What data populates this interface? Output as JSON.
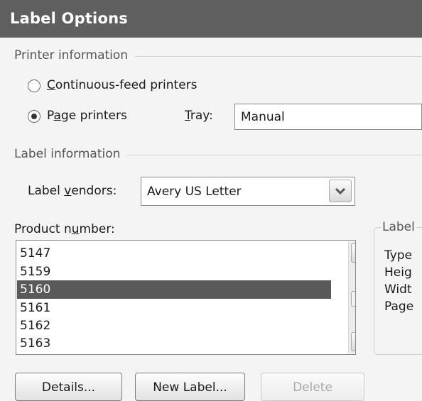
{
  "dialog": {
    "title": "Label Options"
  },
  "printer_info": {
    "group_label": "Printer information",
    "continuous_feed": {
      "label_before": "",
      "label_underlined": "C",
      "label_after": "ontinuous-feed printers",
      "selected": false
    },
    "page_printers": {
      "label_before": "P",
      "label_underlined": "a",
      "label_after": "ge printers",
      "selected": true
    },
    "tray": {
      "label_before": "",
      "label_underlined": "T",
      "label_after": "ray:",
      "value": "Manual"
    }
  },
  "label_info": {
    "group_label": "Label information",
    "vendors": {
      "label_before": "Label ",
      "label_underlined": "v",
      "label_after": "endors:",
      "value": "Avery US Letter"
    }
  },
  "product": {
    "label_before": "Product n",
    "label_underlined": "u",
    "label_after": "mber:",
    "items": [
      "5147",
      "5159",
      "5160",
      "5161",
      "5162",
      "5163"
    ],
    "selected": "5160"
  },
  "label_details": {
    "title": "Label",
    "rows": [
      "Type",
      "Heig",
      "Widt",
      "Page"
    ]
  },
  "buttons": {
    "details": "Details...",
    "new_label": "New Label...",
    "delete": "Delete"
  },
  "icons": {
    "dropdown": "chevron-down-icon",
    "scroll_up": "chevron-up-icon",
    "scroll_down": "chevron-down-icon"
  }
}
